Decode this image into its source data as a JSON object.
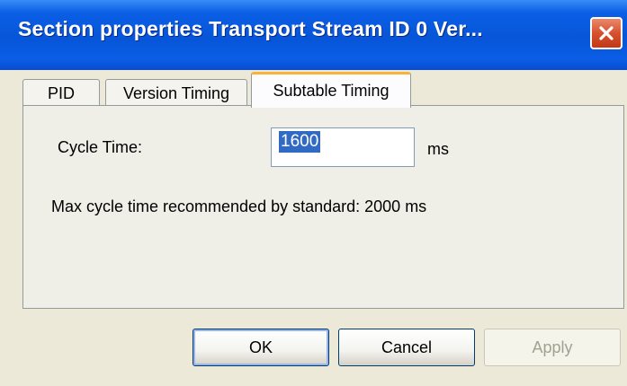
{
  "window": {
    "title": "Section properties Transport Stream ID    0 Ver..."
  },
  "tabs": [
    {
      "label": "PID"
    },
    {
      "label": "Version Timing"
    },
    {
      "label": "Subtable Timing"
    }
  ],
  "active_tab": "Subtable Timing",
  "form": {
    "cycle_time_label": "Cycle Time:",
    "cycle_time_value": "1600",
    "cycle_time_unit": "ms",
    "max_cycle_note": "Max cycle time recommended by standard: 2000 ms"
  },
  "buttons": {
    "ok": "OK",
    "cancel": "Cancel",
    "apply": "Apply"
  },
  "colors": {
    "titlebar": "#0755d8",
    "close_button": "#d6512f",
    "active_tab_accent": "#f9b33a",
    "selection": "#316ac5"
  }
}
